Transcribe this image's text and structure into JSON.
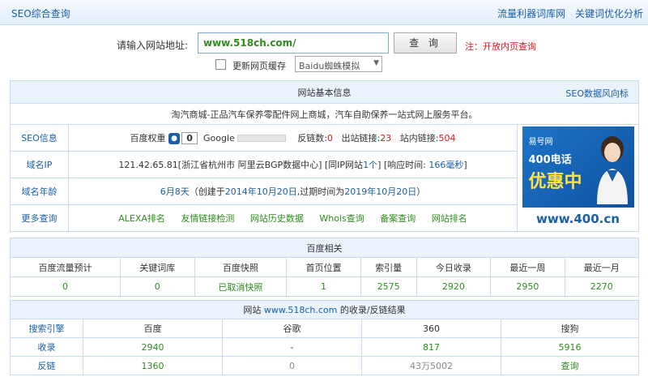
{
  "topbar": {
    "title": "SEO综合查询",
    "links": [
      "流量利器词库网",
      "关键词优化分析"
    ]
  },
  "query": {
    "label": "请输入网站地址:",
    "url_value": "www.518ch.com/",
    "button": "查 询",
    "note": "注：开放内页查询",
    "cache_label": "更新网页缓存",
    "spider_select": "Baidu蜘蛛模拟"
  },
  "info": {
    "heading": "网站基本信息",
    "heading_link": "SEO数据风向标",
    "description": "淘汽商城-正品汽车保养零配件网上商城，汽车自助保养一站式网上服务平台。",
    "seo": {
      "label": "SEO信息",
      "baidu_weight_label": "百度权重",
      "baidu_weight": "0",
      "google_label": "Google",
      "backlinks_label": "反链数:",
      "backlinks": "0",
      "outlinks_label": "出站链接:",
      "outlinks": "23",
      "inlinks_label": "站内链接:",
      "inlinks": "504"
    },
    "ip": {
      "label": "域名IP",
      "text1": "121.42.65.81[浙江省杭州市 阿里云BGP数据中心]  [同IP网站",
      "same_ip_count": "1个",
      "text2": "]  [响应时间:",
      "response": "166毫秒",
      "text3": "]"
    },
    "age": {
      "label": "域名年龄",
      "age": "6月8天",
      "text1": "（创建于",
      "created": "2014年10月20日",
      "text2": ",过期时间为",
      "expires": "2019年10月20日",
      "text3": "）"
    },
    "more": {
      "label": "更多查询",
      "links": [
        "ALEXA排名",
        "友情链接检测",
        "网站历史数据",
        "Whois查询",
        "备案查询",
        "网站排名"
      ]
    },
    "ad": {
      "brand": "易号网",
      "line1": "400电话",
      "line2": "优惠中",
      "footer": "www.400.cn"
    }
  },
  "baidu": {
    "heading": "百度相关",
    "columns": [
      "百度流量预计",
      "关键词库",
      "百度快照",
      "首页位置",
      "索引量",
      "今日收录",
      "最近一周",
      "最近一月"
    ],
    "values": [
      "0",
      "0",
      "已取消快照",
      "1",
      "2575",
      "2920",
      "2950",
      "2270"
    ]
  },
  "site": {
    "heading_pre": "网站",
    "heading_url": "www.518ch.com",
    "heading_post": "的收录/反链结果",
    "columns": [
      "搜索引擎",
      "百度",
      "谷歌",
      "360",
      "搜狗"
    ],
    "rows": [
      {
        "label": "收录",
        "values": [
          "2940",
          "-",
          "817",
          "5916"
        ]
      },
      {
        "label": "反链",
        "values": [
          "1360",
          "0",
          "43万5002",
          "查询"
        ]
      }
    ]
  },
  "colors": {
    "accent": "#1b5fa8",
    "green": "#2e8b1e",
    "red": "#e0131c",
    "border": "#c9daee"
  }
}
